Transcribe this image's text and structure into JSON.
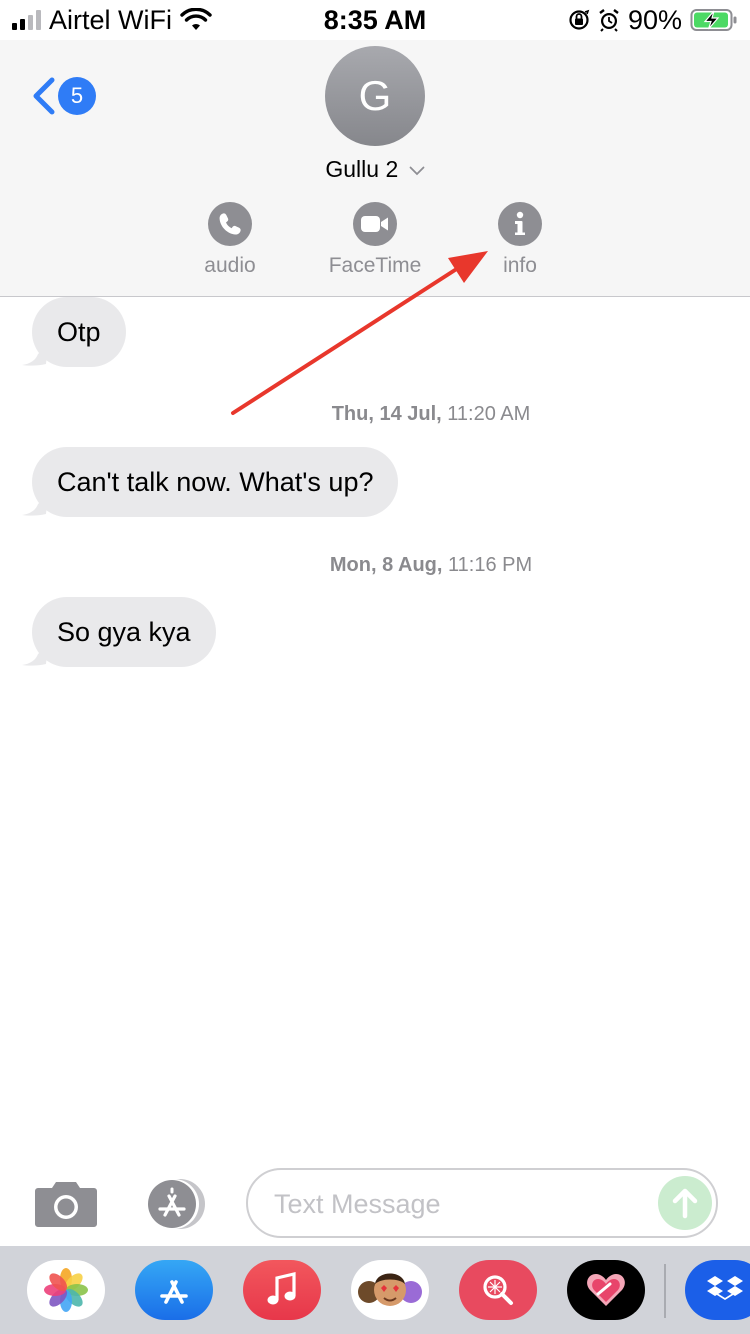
{
  "status_bar": {
    "carrier": "Airtel WiFi",
    "time": "8:35 AM",
    "battery_percent": "90%",
    "signal_bars_active": 2,
    "signal_bars_total": 4,
    "icons": [
      "signal-icon",
      "wifi-icon",
      "orientation-lock-icon",
      "alarm-icon",
      "battery-charging-icon"
    ]
  },
  "header": {
    "back_badge_count": "5",
    "avatar_initial": "G",
    "contact_name": "Gullu 2",
    "actions": [
      {
        "label": "audio",
        "icon": "phone-icon"
      },
      {
        "label": "FaceTime",
        "icon": "video-camera-icon"
      },
      {
        "label": "info",
        "icon": "info-icon"
      }
    ]
  },
  "messages": [
    {
      "type": "incoming",
      "text": "Otp"
    },
    {
      "type": "timestamp",
      "day": "Thu, 14 Jul,",
      "time": "11:20 AM"
    },
    {
      "type": "incoming",
      "text": "Can't talk now. What's up?"
    },
    {
      "type": "timestamp",
      "day": "Mon, 8 Aug,",
      "time": "11:16 PM"
    },
    {
      "type": "incoming",
      "text": "So gya kya"
    }
  ],
  "composer": {
    "placeholder": "Text Message",
    "value": "",
    "icons": [
      "camera-icon",
      "app-store-icon",
      "send-arrow-icon"
    ]
  },
  "app_drawer": {
    "apps": [
      "photos-app-icon",
      "app-store-app-icon",
      "music-app-icon",
      "memoji-app-icon",
      "search-images-app-icon",
      "heart-sticker-app-icon",
      "dropbox-app-icon"
    ]
  },
  "colors": {
    "accent_blue": "#2f7cf6",
    "bubble_gray": "#e9e9eb",
    "annotation_red": "#e8372c",
    "send_green_disabled": "#cbeccf"
  }
}
